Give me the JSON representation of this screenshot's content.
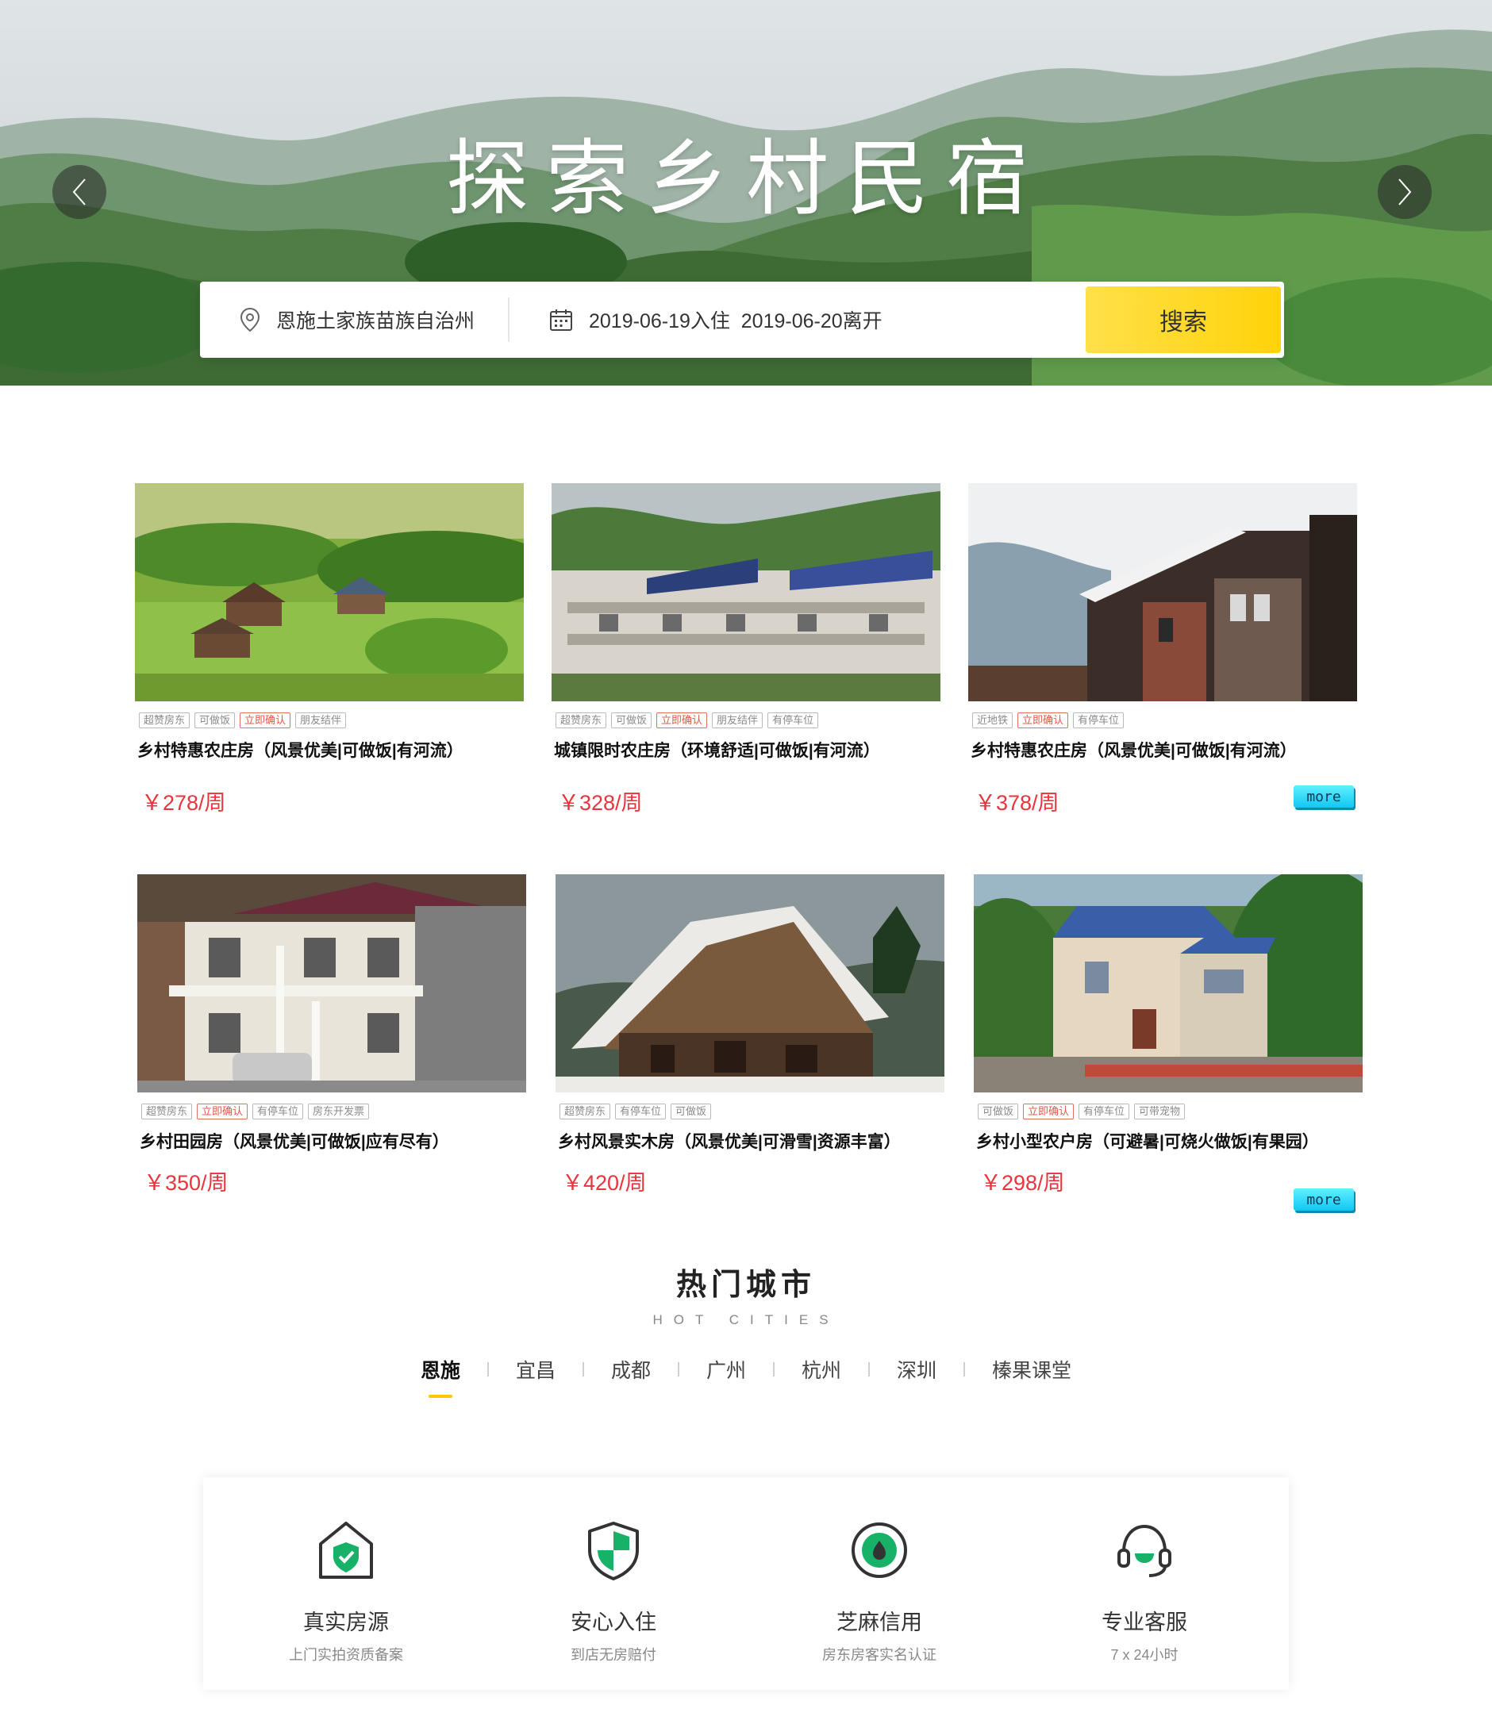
{
  "hero": {
    "title": "探索乡村民宿",
    "prev_label": "previous",
    "next_label": "next"
  },
  "search": {
    "location": "恩施土家族苗族自治州",
    "dates": "2019-06-19入住  2019-06-20离开",
    "button": "搜索"
  },
  "listings": [
    {
      "title": "乡村特惠农庄房（风景优美|可做饭|有河流）",
      "price": "￥278/周",
      "tags": [
        "超赞房东",
        "可做饭",
        "立即确认",
        "朋友结伴"
      ],
      "red_tags": [
        "立即确认"
      ]
    },
    {
      "title": "城镇限时农庄房（环境舒适|可做饭|有河流）",
      "price": "￥328/周",
      "tags": [
        "超赞房东",
        "可做饭",
        "立即确认",
        "朋友结伴",
        "有停车位"
      ],
      "red_tags": [
        "立即确认"
      ]
    },
    {
      "title": "乡村特惠农庄房（风景优美|可做饭|有河流）",
      "price": "￥378/周",
      "tags": [
        "近地铁",
        "立即确认",
        "有停车位"
      ],
      "red_tags": [
        "立即确认"
      ]
    },
    {
      "title": "乡村田园房（风景优美|可做饭|应有尽有）",
      "price": "￥350/周",
      "tags": [
        "超赞房东",
        "立即确认",
        "有停车位",
        "房东开发票"
      ],
      "red_tags": [
        "立即确认"
      ]
    },
    {
      "title": "乡村风景实木房（风景优美|可滑雪|资源丰富）",
      "price": "￥420/周",
      "tags": [
        "超赞房东",
        "有停车位",
        "可做饭"
      ],
      "red_tags": []
    },
    {
      "title": "乡村小型农户房（可避暑|可烧火做饭|有果园）",
      "price": "￥298/周",
      "tags": [
        "可做饭",
        "立即确认",
        "有停车位",
        "可带宠物"
      ],
      "red_tags": [
        "立即确认"
      ]
    }
  ],
  "more_label": "more",
  "hot_cities": {
    "title": "热门城市",
    "subtitle": "HOT CITIES",
    "tabs": [
      "恩施",
      "宜昌",
      "成都",
      "广州",
      "杭州",
      "深圳",
      "榛果课堂"
    ],
    "active": "恩施"
  },
  "features": [
    {
      "title": "真实房源",
      "sub": "上门实拍资质备案",
      "icon": "house-shield-icon"
    },
    {
      "title": "安心入住",
      "sub": "到店无房赔付",
      "icon": "shield-icon"
    },
    {
      "title": "芝麻信用",
      "sub": "房东房客实名认证",
      "icon": "drop-circle-icon"
    },
    {
      "title": "专业客服",
      "sub": "7 x 24小时",
      "icon": "headset-icon"
    }
  ],
  "colors": {
    "accent_yellow": "#ffd30a",
    "price_red": "#e8343c",
    "more_cyan": "#11c7f2",
    "icon_green": "#17b267"
  }
}
